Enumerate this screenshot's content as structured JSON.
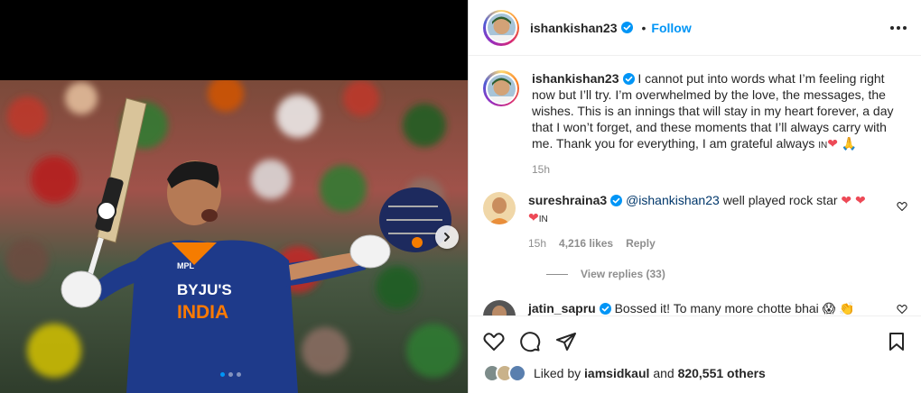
{
  "post": {
    "username": "ishankishan23",
    "follow_label": "Follow",
    "bullet": "•"
  },
  "caption": {
    "username": "ishankishan23",
    "text": "I cannot put into words what I’m feeling right now but I’ll try. I’m overwhelmed by the love, the messages, the wishes. This is an innings that will stay in my heart forever, a day that I won’t forget, and these moments that I’ll always carry with me. Thank you for everything, I am grateful always",
    "suffix": "IN",
    "emoji_heart": "❤",
    "emoji_hands": "🙏",
    "time": "15h"
  },
  "comments": [
    {
      "username": "sureshraina3",
      "mention": "@ishankishan23",
      "text": "well played rock star",
      "emoji1": "❤",
      "emoji2": "❤",
      "emoji3": "❤",
      "flag": "IN",
      "time": "15h",
      "likes": "4,216 likes",
      "reply": "Reply",
      "view_replies": "View replies (33)"
    },
    {
      "username": "jatin_sapru",
      "text": "Bossed it! To many more chotte bhai",
      "emoji1": "😱",
      "emoji2": "👏"
    }
  ],
  "likes_line": {
    "prefix": "Liked by",
    "user": "iamsidkaul",
    "and": "and",
    "others": "820,551 others"
  },
  "photo_text": {
    "jersey_brand": "BYJU'S",
    "jersey_country": "INDIA",
    "collar": "MPL"
  },
  "carousel": {
    "current": 1,
    "total": 3
  },
  "icons": [
    "verified-icon",
    "more-icon",
    "heart-icon",
    "comment-icon",
    "share-icon",
    "save-icon",
    "chevron-right-icon"
  ],
  "colors": {
    "accent": "#0095f6",
    "jersey": "#1e3a8a",
    "heart": "#ed4956"
  }
}
